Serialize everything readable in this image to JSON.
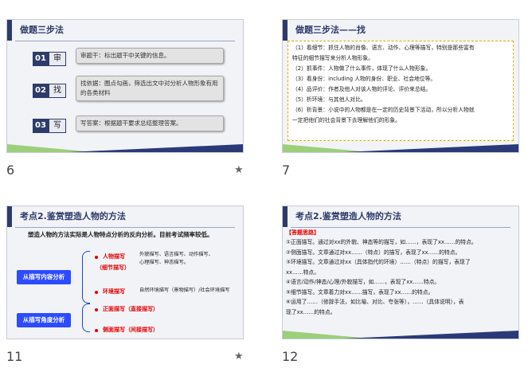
{
  "colors": {
    "navy": "#2d3b6a",
    "green": "#9ccf7a",
    "red": "#e10000",
    "blue": "#2d4bff",
    "dash": "#d7b000"
  },
  "slides": [
    {
      "number": "6",
      "title": "做题三步法",
      "starred": true,
      "star_icon": "★",
      "steps": [
        {
          "num": "01",
          "key": "审",
          "text": "审题干：标出题干中关键的信息。"
        },
        {
          "num": "02",
          "key": "找",
          "text": "找依据：圈点勾画，筛选出文中对分析人物形象有用的各类材料"
        },
        {
          "num": "03",
          "key": "写",
          "text": "写答案：根据题干要求总结整理答案。"
        }
      ]
    },
    {
      "number": "7",
      "title": "做题三步法——找",
      "starred": false,
      "lines": [
        "（1）看细节：抓住人物的肖像、语言、动作、心理等描写，特别是那些富有",
        "特征的细节描写来分析人物形象。",
        "（2）抓事件：人物做了什么事件，体现了什么人物形象。",
        "（3）看身份：including 人物的身份、职业、社会地位等。",
        "（4）品评价：作者及他人对该人物的评论、评价来总结。",
        "（5）析环境：与其他人对比。",
        "（6）析背景：小说中的人物都是在一定的历史背景下活动，所以分析人物就",
        "一定把他们的社会背景下去理解他们的形象。"
      ]
    },
    {
      "number": "11",
      "title": "考点2.鉴赏塑造人物的方法",
      "starred": true,
      "star_icon": "★",
      "lead": "塑造人物的方法实际是人物特点分析的反向分析。目前考试频率较低。",
      "left_btns": [
        "从描写内容分析",
        "从描写角度分析"
      ],
      "items": [
        {
          "label": "人物描写",
          "detail": "外貌描写、语言描写、动作描写、",
          "detail2": "心理描写、神态描写。",
          "sub": "（细节描写）"
        },
        {
          "label": "环境描写",
          "detail": "自然环境描写（景物描写）/社会环境描写"
        },
        {
          "label": "正面描写（直接描写）"
        },
        {
          "label": "侧面描写（间接描写）"
        }
      ]
    },
    {
      "number": "12",
      "title": "考点2.鉴赏塑造人物的方法",
      "starred": false,
      "heading": "【答题思路】",
      "lines": [
        "①正面描写。通过对xx的外貌、神态等的描写，如……，表现了xx……的特点。",
        "②侧面描写。文章通过对xx……（特点）的描写，表现了xx……的特点。",
        "③环境描写。文章通过对xx（具体指代的环境）……（特点）的描写，表现了",
        "xx……特点。",
        "④语言/动作/神态/心理/外貌描写，如……，表现了xx……特点。",
        "⑤细节描写。文章着力对xx……描写，表现了xx……的特点。",
        "⑥运用了……（修辞手法，如比喻、对比、夸张等），……（具体说明），表",
        "现了xx……的特点。"
      ]
    }
  ]
}
